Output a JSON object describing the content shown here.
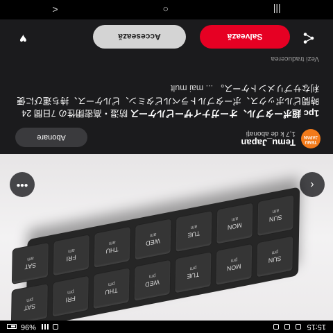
{
  "status_bar": {
    "time": "15:15",
    "battery": "%96"
  },
  "photo": {
    "watermark": "",
    "organizer": {
      "top_row": [
        "SUN pm",
        "MON pm",
        "TUE pm",
        "WED pm",
        "THU pm",
        "FRI pm",
        "SAT pm"
      ],
      "bottom_row": [
        "SUN am",
        "MON am",
        "TUE am",
        "WED am",
        "THU am",
        "FRI am",
        "SAT am"
      ]
    }
  },
  "account": {
    "logo_text": "TEMU JAPAN",
    "name": "Temu_Japan",
    "subscribers": "1,7 k de abonați",
    "follow_label": "Abonare"
  },
  "description": {
    "caption": "1pc 超ポータブル、オーガナイザーピルケース",
    "body": "防湿・高密閉性の 7日間 24時間ピルボックス、ポータブルトラベルビタミン、ピルケース、持ち運びに便利なサプリメントケース。",
    "more": "... mai mult",
    "translate": "Vezi traducerea"
  },
  "actions": {
    "save_label": "Salvează",
    "access_label": "Accesează"
  },
  "nav": {
    "back": "<",
    "home": "○",
    "recents": "|||"
  },
  "colors": {
    "save_button": "#e60023",
    "access_button": "#d4d4d4",
    "logo": "#f27a1a"
  }
}
